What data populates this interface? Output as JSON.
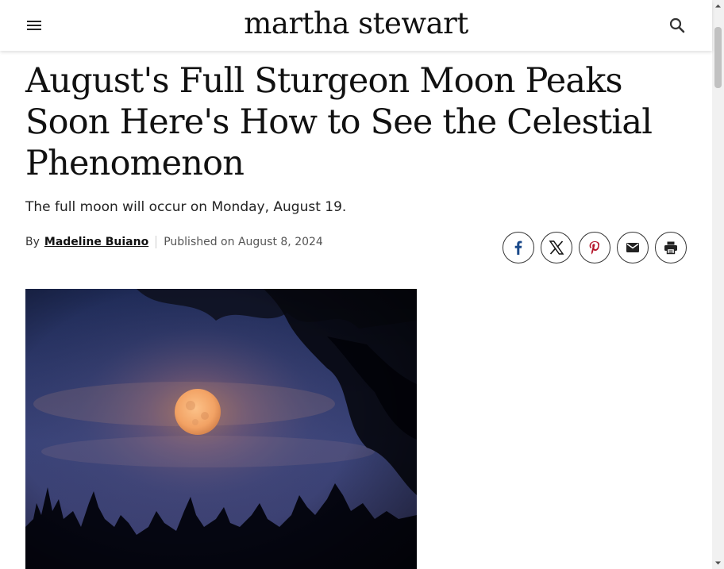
{
  "header": {
    "logo": "martha stewart",
    "menu_icon": "hamburger-menu-icon",
    "search_icon": "search-icon"
  },
  "article": {
    "title": "August's Full Sturgeon Moon Peaks Soon Here's How to See the Celestial Phenomenon",
    "subtitle": "The full moon will occur on Monday, August 19.",
    "byline": {
      "by": "By",
      "author": "Madeline Buiano",
      "published": "Published on August 8, 2024"
    },
    "share": [
      {
        "icon": "facebook-icon",
        "color": "#1b4a8a"
      },
      {
        "icon": "x-icon",
        "color": "#111111"
      },
      {
        "icon": "pinterest-icon",
        "color": "#b5162b"
      },
      {
        "icon": "email-icon",
        "color": "#222222"
      },
      {
        "icon": "print-icon",
        "color": "#222222"
      }
    ],
    "hero_image": "full-moon-night-sky-image"
  }
}
